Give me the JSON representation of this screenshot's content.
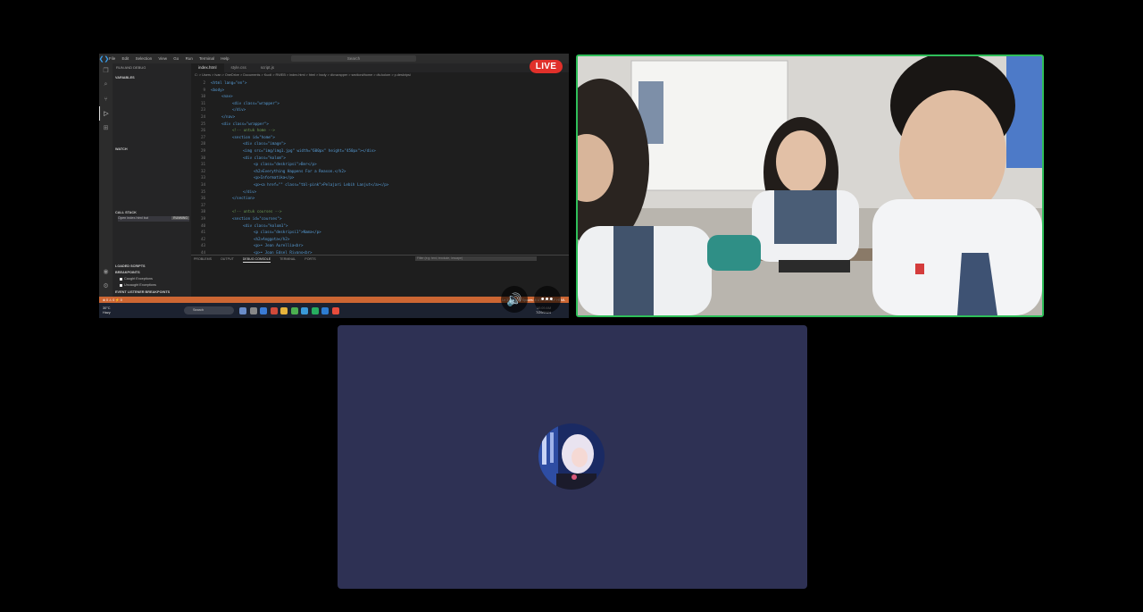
{
  "live_badge": "LIVE",
  "screen_share": {
    "menu": [
      "File",
      "Edit",
      "Selection",
      "View",
      "Go",
      "Run",
      "Terminal",
      "Help"
    ],
    "search_placeholder": "Search",
    "sidebar_title": "RUN AND DEBUG",
    "sections": {
      "variables": "VARIABLES",
      "watch": "WATCH",
      "call_stack": "CALL STACK",
      "loaded_scripts": "LOADED SCRIPTS",
      "breakpoints": "BREAKPOINTS",
      "event_listener_breakpoints": "EVENT LISTENER BREAKPOINTS"
    },
    "call_stack_item": "Open index.html but",
    "call_stack_badge": "RUNNING",
    "breakpoints": [
      "Caught Exceptions",
      "Uncaught Exceptions"
    ],
    "tabs": [
      {
        "label": "index.html",
        "active": true
      },
      {
        "label": "style.css",
        "active": false
      },
      {
        "label": "script.js",
        "active": false
      }
    ],
    "breadcrumbs": "C: > Users > Ivan > OneDrive > Documents > Kuoli > RWEB > index.html > html > body > div.wrapper > section#home > div.kolom > p.deskripsi",
    "code_lines": [
      {
        "n": "2",
        "t": "<html lang=\"en\">",
        "i": 0
      },
      {
        "n": "9",
        "t": "<body>",
        "i": 0
      },
      {
        "n": "10",
        "t": "<nav>",
        "i": 1
      },
      {
        "n": "11",
        "t": "<div class=\"wrapper\">",
        "i": 2
      },
      {
        "n": "23",
        "t": "</div>",
        "i": 2
      },
      {
        "n": "24",
        "t": "</nav>",
        "i": 1
      },
      {
        "n": "25",
        "t": "<div class=\"wrapper\">",
        "i": 1
      },
      {
        "n": "26",
        "t": "<!-- untuk home -->",
        "i": 2
      },
      {
        "n": "27",
        "t": "<section id=\"home\">",
        "i": 2
      },
      {
        "n": "28",
        "t": "<div class=\"image\">",
        "i": 3
      },
      {
        "n": "29",
        "t": "<img src=\"img/img1.jpg\" width=\"600px\" height=\"450px\"></div>",
        "i": 3
      },
      {
        "n": "30",
        "t": "<div class=\"kolom\">",
        "i": 3
      },
      {
        "n": "31",
        "t": "<p class=\"deskripsi\">Ber</p>",
        "i": 4
      },
      {
        "n": "32",
        "t": "<h2>Everything Happens For a Reason.</h2>",
        "i": 4
      },
      {
        "n": "33",
        "t": "<p>Informatika</p>",
        "i": 4
      },
      {
        "n": "34",
        "t": "<p><a href=\"\" class=\"tbl-pink\">Pelajari Lebih Lanjut</a></p>",
        "i": 4
      },
      {
        "n": "35",
        "t": "</div>",
        "i": 3
      },
      {
        "n": "36",
        "t": "</section>",
        "i": 2
      },
      {
        "n": "37",
        "t": "",
        "i": 0
      },
      {
        "n": "38",
        "t": "<!-- untuk courses -->",
        "i": 2
      },
      {
        "n": "39",
        "t": "<section id=\"courses\">",
        "i": 2
      },
      {
        "n": "40",
        "t": "<div class=\"kolom1\">",
        "i": 3
      },
      {
        "n": "41",
        "t": "<p class=\"deskripsi1\">Nama</p>",
        "i": 4
      },
      {
        "n": "42",
        "t": "<h2>Anggota</h2>",
        "i": 4
      },
      {
        "n": "43",
        "t": "<p>• Jean Aurellia<br>",
        "i": 4
      },
      {
        "n": "44",
        "t": "<p>• Joan Edsel Rivano<br>",
        "i": 4
      }
    ],
    "panel_tabs": [
      {
        "label": "PROBLEMS",
        "active": false
      },
      {
        "label": "OUTPUT",
        "active": false
      },
      {
        "label": "DEBUG CONSOLE",
        "active": true
      },
      {
        "label": "TERMINAL",
        "active": false
      },
      {
        "label": "PORTS",
        "active": false
      }
    ],
    "panel_filter": "Filter (e.g. text, !exclude, \\escape)",
    "status_left": "⊗ 0 ⚠ 0  ⚡ 0",
    "status_right": "Ln 31, Col 30   Spaces: 4   UTF-8   CRLF   HTML",
    "taskbar": {
      "weather_temp": "30°C",
      "weather_desc": "Hazy",
      "search": "Search",
      "time": "10:09 AM",
      "date": "7/29/2024"
    }
  },
  "controls": {
    "speaker_icon": "speaker-icon",
    "more_icon": "more-options-icon",
    "more_label": "•••"
  },
  "colors": {
    "live": "#e0302a",
    "active_speaker_border": "#2fbf5a",
    "avatar_tile_bg": "#2e3154",
    "status_bar": "#cc6633"
  }
}
